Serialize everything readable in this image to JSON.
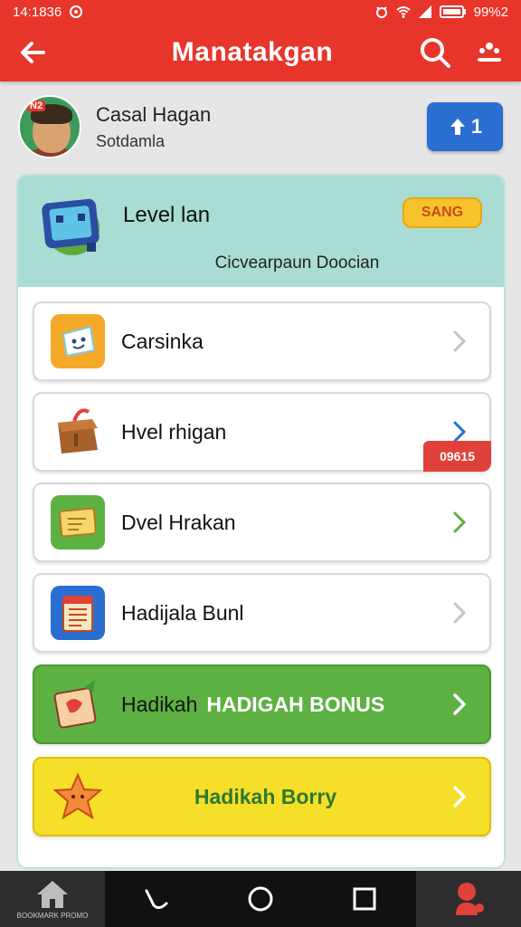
{
  "status": {
    "time": "14:1836",
    "battery": "99%2"
  },
  "header": {
    "title": "Manatakgan"
  },
  "profile": {
    "name": "Casal Hagan",
    "subtitle": "Sotdamla",
    "avatar_badge": "N2",
    "button_label": "1"
  },
  "level": {
    "title": "Level lan",
    "badge": "SANG",
    "subtitle": "Cicvearpaun Doocian"
  },
  "menu": [
    {
      "label": "Carsinka",
      "icon": "sticker-icon"
    },
    {
      "label": "Hvel rhigan",
      "icon": "bag-icon",
      "tag": "09615"
    },
    {
      "label": "Dvel Hrakan",
      "icon": "note-icon"
    },
    {
      "label": "Hadijala Bunl",
      "icon": "calendar-icon"
    },
    {
      "label": "Hadikah",
      "bonus": "HADIGAH BONUS",
      "icon": "gift-icon"
    },
    {
      "label": "Hadikah Borry",
      "icon": "star-icon"
    }
  ],
  "nav": {
    "home_caption": "BOOKMARK PROMO"
  },
  "colors": {
    "primary": "#e8352b",
    "green": "#5db142",
    "yellow": "#f6df28",
    "teal": "#a9dcd3",
    "blue": "#2a6ed1"
  }
}
